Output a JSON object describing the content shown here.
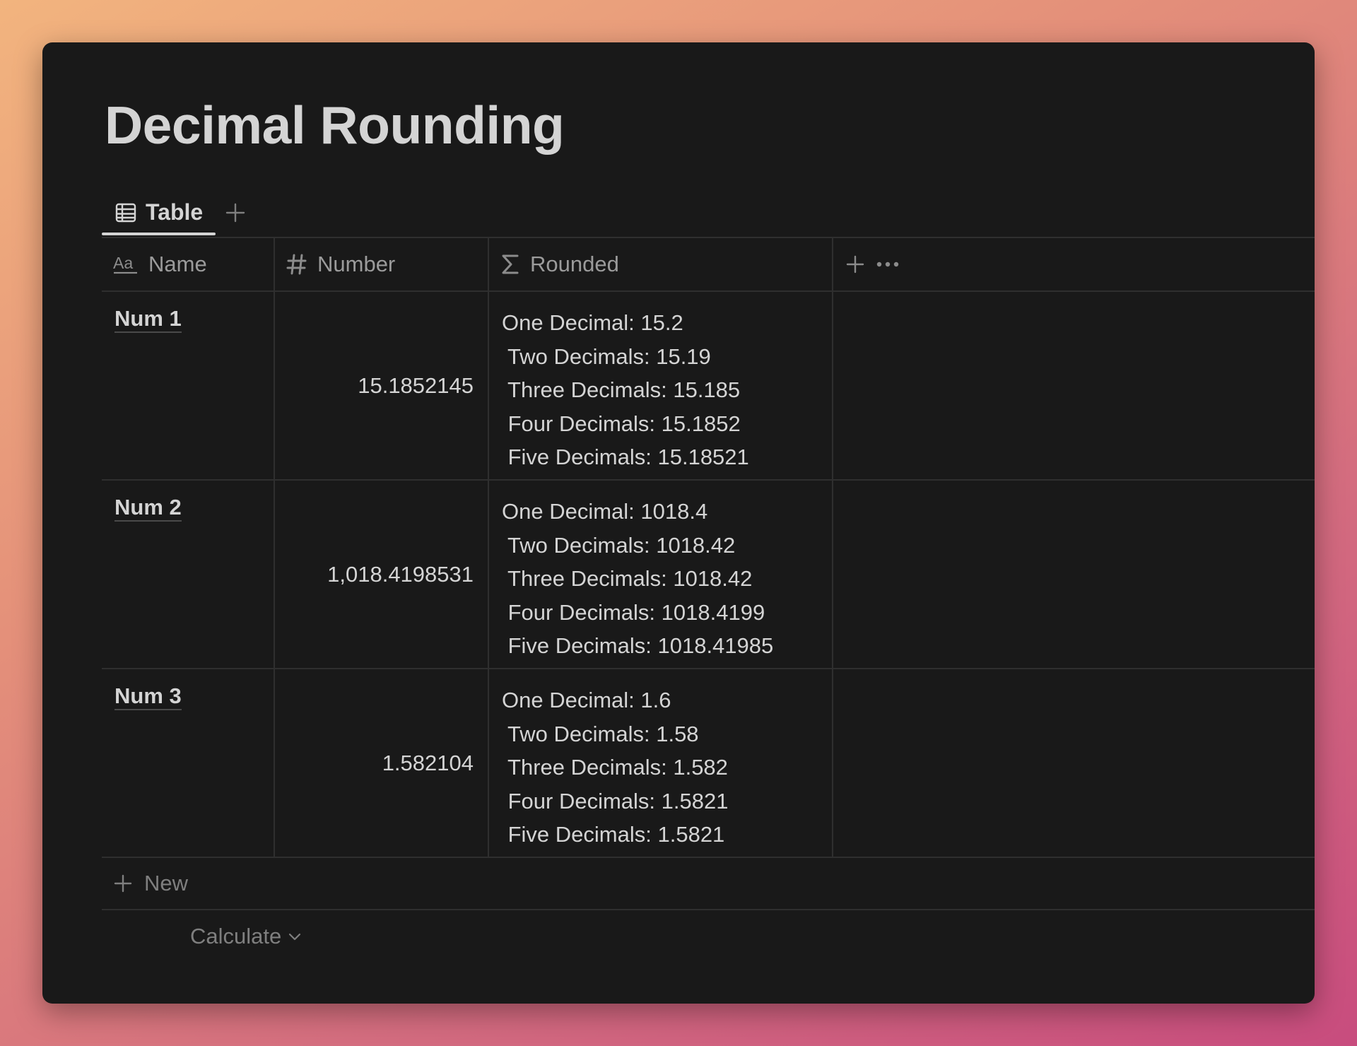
{
  "page": {
    "title": "Decimal Rounding"
  },
  "views": {
    "active_tab": "Table"
  },
  "table": {
    "columns": [
      {
        "label": "Name",
        "icon": "text-icon"
      },
      {
        "label": "Number",
        "icon": "hash-icon"
      },
      {
        "label": "Rounded",
        "icon": "sigma-icon"
      }
    ],
    "rows": [
      {
        "name": "Num 1",
        "number": "15.1852145",
        "rounded": [
          "One Decimal: 15.2",
          " Two Decimals: 15.19",
          " Three Decimals: 15.185",
          " Four Decimals: 15.1852",
          " Five Decimals: 15.18521"
        ]
      },
      {
        "name": "Num 2",
        "number": "1,018.4198531",
        "rounded": [
          "One Decimal: 1018.4",
          " Two Decimals: 1018.42",
          " Three Decimals: 1018.42",
          " Four Decimals: 1018.4199",
          " Five Decimals: 1018.41985"
        ]
      },
      {
        "name": "Num 3",
        "number": "1.582104",
        "rounded": [
          "One Decimal: 1.6",
          " Two Decimals: 1.58",
          " Three Decimals: 1.582",
          " Four Decimals: 1.5821",
          " Five Decimals: 1.5821"
        ]
      }
    ],
    "new_label": "New",
    "calculate_label": "Calculate"
  },
  "colors": {
    "window_bg": "#191919",
    "text_primary": "#d4d4d4",
    "text_muted": "#9b9b9b",
    "border": "#2f2f2f"
  }
}
